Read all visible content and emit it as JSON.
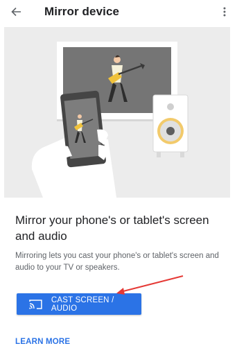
{
  "app_bar": {
    "back_icon": "arrow-back-icon",
    "title": "Mirror device",
    "overflow_icon": "more-vert-icon"
  },
  "hero": {
    "illustration": "phone-mirroring-to-tv-and-speaker-illustration"
  },
  "main": {
    "headline": "Mirror your phone's or tablet's screen and audio",
    "description": "Mirroring lets you cast your phone's or tablet's screen and audio to your TV or speakers.",
    "cast_button": {
      "icon": "cast-icon",
      "label": "CAST SCREEN / AUDIO"
    },
    "learn_more": "LEARN MORE"
  },
  "colors": {
    "accent": "#2b73e6",
    "annotation_arrow": "#e53935",
    "hero_background": "#ececec"
  }
}
